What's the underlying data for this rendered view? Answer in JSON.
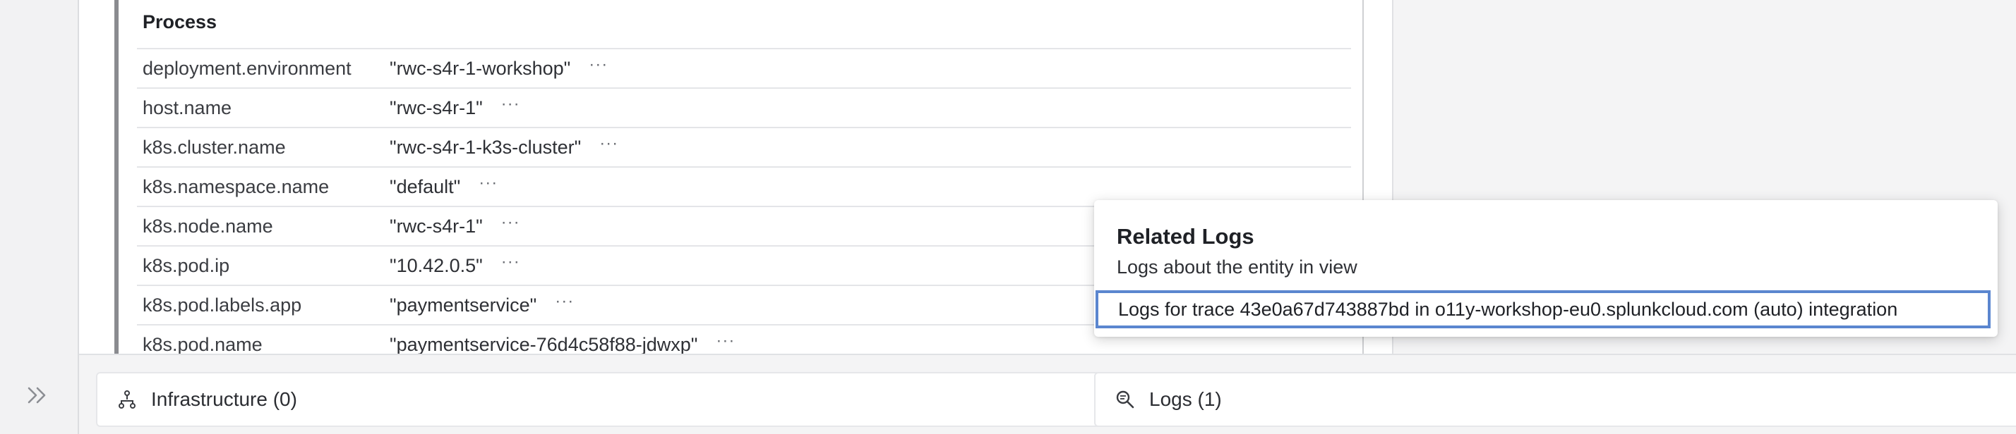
{
  "panel": {
    "section_title": "Process",
    "rows": [
      {
        "key": "deployment.environment",
        "value": "\"rwc-s4r-1-workshop\"",
        "more": "···"
      },
      {
        "key": "host.name",
        "value": "\"rwc-s4r-1\"",
        "more": "···"
      },
      {
        "key": "k8s.cluster.name",
        "value": "\"rwc-s4r-1-k3s-cluster\"",
        "more": "···"
      },
      {
        "key": "k8s.namespace.name",
        "value": "\"default\"",
        "more": "···"
      },
      {
        "key": "k8s.node.name",
        "value": "\"rwc-s4r-1\"",
        "more": "···"
      },
      {
        "key": "k8s.pod.ip",
        "value": "\"10.42.0.5\"",
        "more": "···"
      },
      {
        "key": "k8s.pod.labels.app",
        "value": "\"paymentservice\"",
        "more": "···"
      },
      {
        "key": "k8s.pod.name",
        "value": "\"paymentservice-76d4c58f88-jdwxp\"",
        "more": "···"
      }
    ]
  },
  "bottom": {
    "infra_label": "Infrastructure (0)",
    "logs_label": "Logs (1)"
  },
  "popup": {
    "title": "Related Logs",
    "subtitle": "Logs about the entity in view",
    "link": "Logs for trace 43e0a67d743887bd in o11y-workshop-eu0.splunkcloud.com (auto) integration"
  },
  "icons": {
    "expand": "double-chevron-right-icon",
    "infra": "hierarchy-icon",
    "logs": "magnify-logs-icon"
  },
  "colors": {
    "focus_border": "#5b86cf",
    "panel_rule": "#8a8b8f"
  }
}
